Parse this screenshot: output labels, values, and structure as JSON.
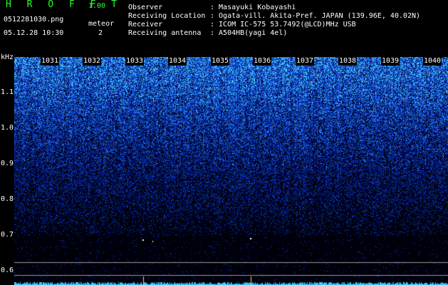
{
  "app": {
    "title": "H R O F F T",
    "version": "1.00"
  },
  "file": {
    "name": "0512281030.png",
    "datetime": "05.12.28 10:30"
  },
  "meteor": {
    "label": "meteor",
    "count": "2"
  },
  "station": [
    {
      "label": "Observer",
      "value": ": Masayuki Kobayashi"
    },
    {
      "label": "Receiving Location",
      "value": ": Ogata-vill. Akita-Pref. JAPAN (139.96E, 40.02N)"
    },
    {
      "label": "Receiver",
      "value": ": ICOM IC-575 53.7492(@LCD)MHz USB"
    },
    {
      "label": "Receiving antenna",
      "value": ": A504HB(yagi 4el)"
    }
  ],
  "spectrogram": {
    "y_unit": "kHz",
    "y_ticks": [
      "1.1",
      "1.0",
      "0.9",
      "0.8",
      "0.7",
      "0.6"
    ],
    "time_ticks": [
      "1031",
      "1032",
      "1033",
      "1034",
      "1035",
      "1036",
      "1037",
      "1038",
      "1039",
      "1040"
    ],
    "colors": {
      "background": "#000010",
      "signal_low": "#0a1ea0",
      "signal_high": "#3ee0ff",
      "ref_line": "#9a9a9a"
    }
  }
}
